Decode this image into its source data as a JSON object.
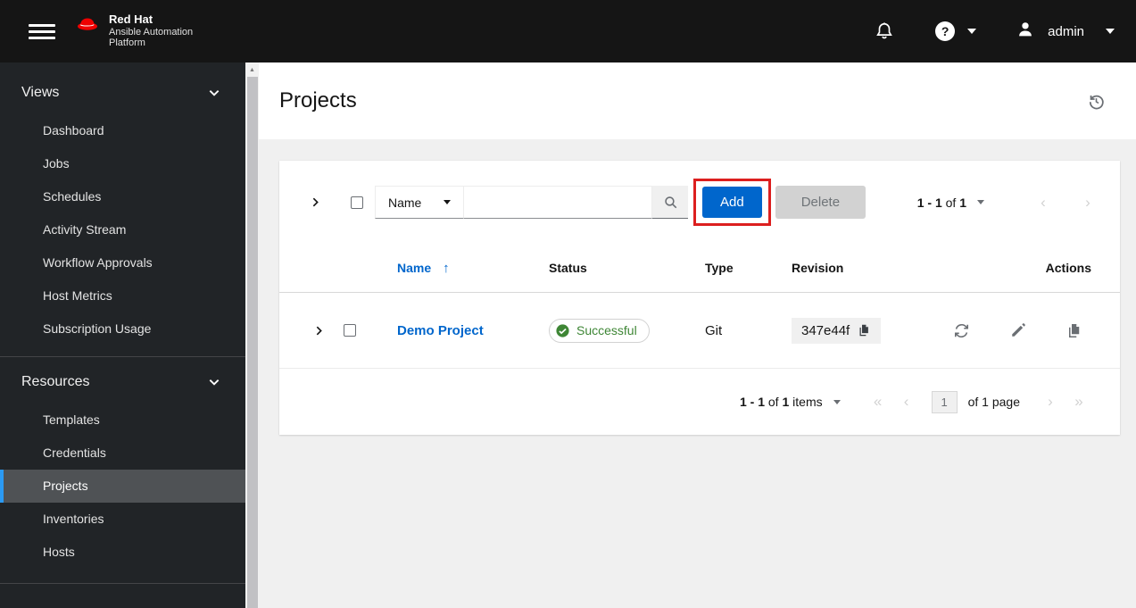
{
  "masthead": {
    "brand": {
      "line1": "Red Hat",
      "line2": "Ansible Automation",
      "line3": "Platform"
    },
    "user": "admin"
  },
  "sidebar": {
    "groups": [
      {
        "label": "Views",
        "items": [
          {
            "label": "Dashboard"
          },
          {
            "label": "Jobs"
          },
          {
            "label": "Schedules"
          },
          {
            "label": "Activity Stream"
          },
          {
            "label": "Workflow Approvals"
          },
          {
            "label": "Host Metrics"
          },
          {
            "label": "Subscription Usage"
          }
        ]
      },
      {
        "label": "Resources",
        "items": [
          {
            "label": "Templates"
          },
          {
            "label": "Credentials"
          },
          {
            "label": "Projects",
            "selected": true
          },
          {
            "label": "Inventories"
          },
          {
            "label": "Hosts"
          }
        ]
      }
    ]
  },
  "page": {
    "title": "Projects"
  },
  "toolbar": {
    "filter": {
      "selected": "Name"
    },
    "search": {
      "value": "",
      "placeholder": ""
    },
    "add_label": "Add",
    "delete_label": "Delete",
    "pagination": {
      "range": "1 - 1",
      "of": "of",
      "total": "1"
    }
  },
  "table": {
    "headers": [
      "Name",
      "Status",
      "Type",
      "Revision",
      "Actions"
    ],
    "rows": [
      {
        "name": "Demo Project",
        "status": "Successful",
        "type": "Git",
        "revision": "347e44f"
      }
    ]
  },
  "footer": {
    "pagination": {
      "range": "1 - 1",
      "of": "of",
      "total": "1",
      "items_word": "items"
    },
    "page": {
      "value": "1",
      "label": "of 1 page"
    }
  },
  "icons": {
    "help": "?",
    "scroll_up": "▲",
    "sort_up": "↑",
    "angle_double_left": "«",
    "angle_left": "‹",
    "angle_right": "›",
    "angle_double_right": "»"
  },
  "colors": {
    "accent_blue": "#0066cc",
    "success_green": "#3e8635",
    "annotation_red": "#dc1f1f",
    "nav_selected_bar": "#2b9af3",
    "masthead_bg": "#151515",
    "sidebar_bg": "#212427"
  }
}
